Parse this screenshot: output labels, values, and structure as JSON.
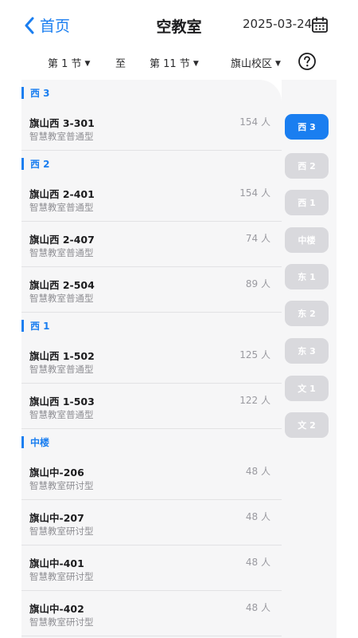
{
  "nav": {
    "back_label": "首页",
    "title": "空教室",
    "date": "2025-03-24"
  },
  "filters": {
    "start": "第 1 节",
    "to": "至",
    "end": "第 11 节",
    "campus": "旗山校区"
  },
  "sections": [
    {
      "name": "西 3",
      "rooms": [
        {
          "name": "旗山西 3-301",
          "type": "智慧教室普通型",
          "capacity": "154 人"
        }
      ]
    },
    {
      "name": "西 2",
      "rooms": [
        {
          "name": "旗山西 2-401",
          "type": "智慧教室普通型",
          "capacity": "154 人"
        },
        {
          "name": "旗山西 2-407",
          "type": "智慧教室普通型",
          "capacity": "74 人"
        },
        {
          "name": "旗山西 2-504",
          "type": "智慧教室普通型",
          "capacity": "89 人"
        }
      ]
    },
    {
      "name": "西 1",
      "rooms": [
        {
          "name": "旗山西 1-502",
          "type": "智慧教室普通型",
          "capacity": "125 人"
        },
        {
          "name": "旗山西 1-503",
          "type": "智慧教室普通型",
          "capacity": "122 人"
        }
      ]
    },
    {
      "name": "中楼",
      "rooms": [
        {
          "name": "旗山中-206",
          "type": "智慧教室研讨型",
          "capacity": "48 人"
        },
        {
          "name": "旗山中-207",
          "type": "智慧教室研讨型",
          "capacity": "48 人"
        },
        {
          "name": "旗山中-401",
          "type": "智慧教室研讨型",
          "capacity": "48 人"
        },
        {
          "name": "旗山中-402",
          "type": "智慧教室研讨型",
          "capacity": "48 人"
        }
      ]
    }
  ],
  "index": [
    "西 3",
    "西 2",
    "西 1",
    "中楼",
    "东 1",
    "东 2",
    "东 3",
    "文 1",
    "文 2"
  ],
  "active_index": "西 3",
  "colors": {
    "accent": "#1a7ef0",
    "index_inactive": "#d9d9dd",
    "list_bg": "#f6f6f7"
  }
}
